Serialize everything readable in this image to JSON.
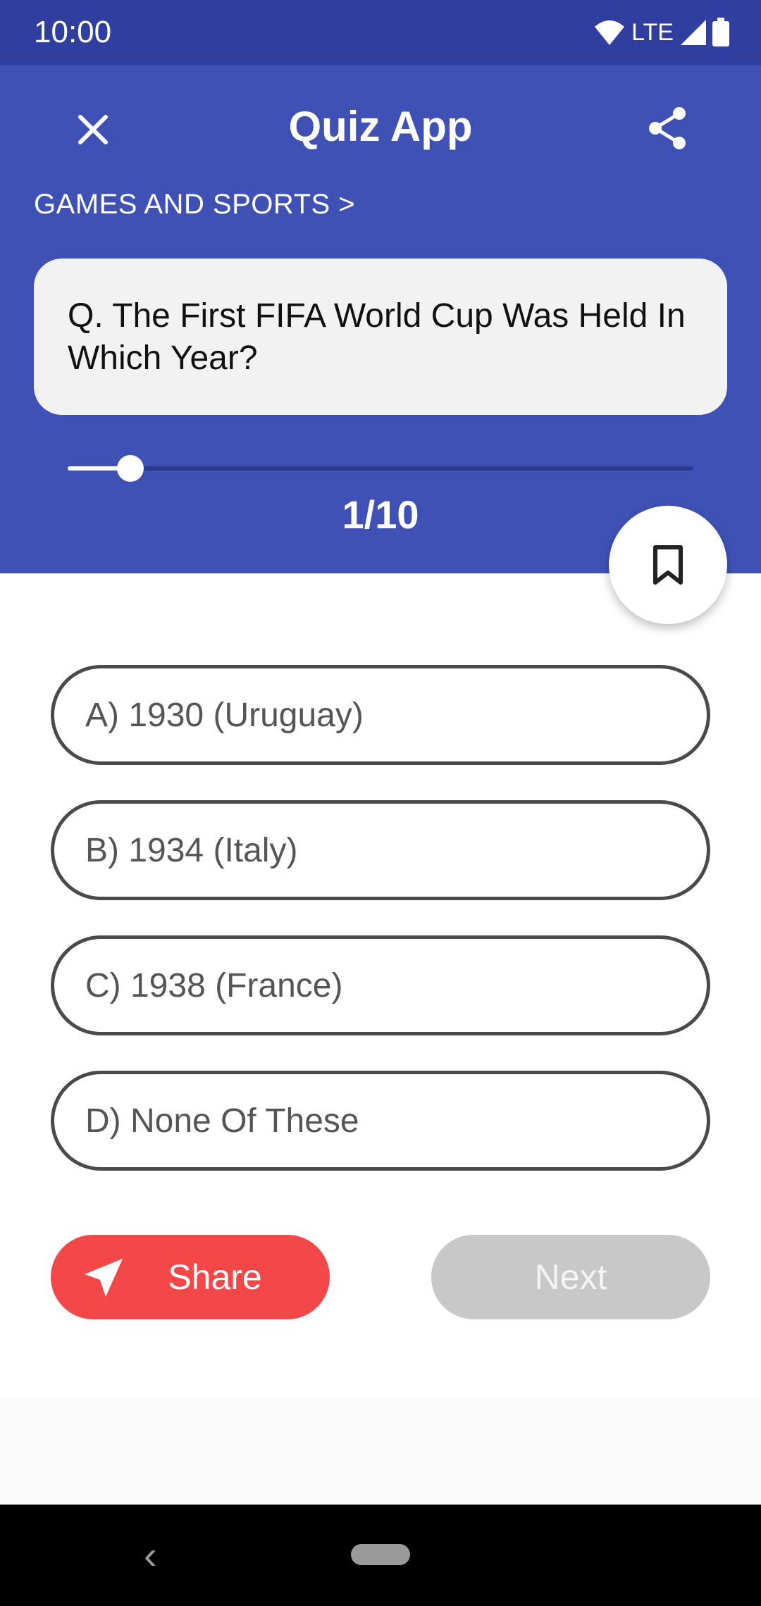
{
  "status_bar": {
    "time": "10:00",
    "network": "LTE"
  },
  "header": {
    "title": "Quiz App",
    "category": "GAMES AND SPORTS >",
    "question": "Q. The First FIFA World Cup Was Held In Which Year?",
    "progress": {
      "label": "1/10",
      "current": 1,
      "total": 10
    }
  },
  "options": [
    {
      "label": "A) 1930 (Uruguay)"
    },
    {
      "label": "B) 1934 (Italy)"
    },
    {
      "label": "C) 1938 (France)"
    },
    {
      "label": "D) None Of These"
    }
  ],
  "actions": {
    "share_label": "Share",
    "next_label": "Next"
  },
  "icons": {
    "close": "close-icon",
    "share_top": "share-icon",
    "bookmark": "bookmark-icon",
    "send": "send-icon",
    "wifi": "wifi-icon",
    "signal": "signal-icon",
    "battery": "battery-icon",
    "back": "back-icon",
    "home": "home-pill"
  },
  "colors": {
    "status_bar": "#303f9f",
    "primary": "#3f51b5",
    "card": "#f2f2f2",
    "share_button": "#f44848",
    "next_button_disabled": "#c8c8c8",
    "nav_bar": "#000000"
  }
}
